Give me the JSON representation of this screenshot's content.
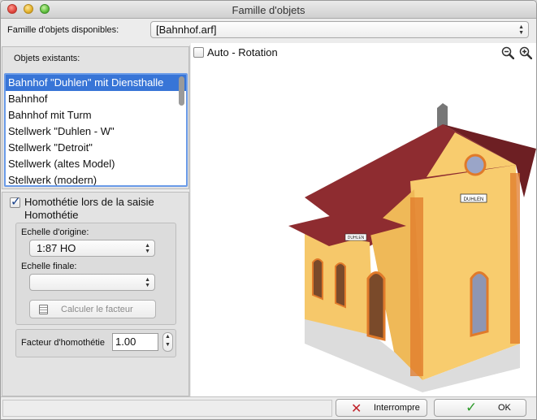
{
  "window": {
    "title": "Famille d'objets"
  },
  "family": {
    "label": "Famille d'objets disponibles:",
    "selected": "[Bahnhof.arf]"
  },
  "objects": {
    "label": "Objets existants:",
    "items": [
      {
        "label": "Bahnhof \"Duhlen\" mit Diensthalle"
      },
      {
        "label": "Bahnhof"
      },
      {
        "label": "Bahnhof mit Turm"
      },
      {
        "label": "Stellwerk \"Duhlen - W\""
      },
      {
        "label": "Stellwerk \"Detroit\""
      },
      {
        "label": "Stellwerk (altes Model)"
      },
      {
        "label": "Stellwerk (modern)"
      }
    ],
    "selected_index": 0
  },
  "homothetie": {
    "checkbox_label": "Homothétie lors de la saisie",
    "checked": true,
    "group_title": "Homothétie",
    "origin_label": "Echelle d'origine:",
    "origin_value": "1:87 HO",
    "final_label": "Echelle finale:",
    "final_value": "",
    "calc_button": "Calculer le facteur",
    "factor_label": "Facteur d'homothétie",
    "factor_value": "1.00"
  },
  "viewer": {
    "auto_rotation_label": "Auto - Rotation",
    "auto_rotation_checked": false,
    "building_sign_1": "DUHLEN",
    "building_sign_2": "DUHLEN"
  },
  "footer": {
    "cancel_label": "Interrompre",
    "ok_label": "OK"
  },
  "colors": {
    "wall": "#f8cc6e",
    "roof": "#8b2a2e",
    "brick": "#e07a2a",
    "selection": "#3875d7"
  }
}
